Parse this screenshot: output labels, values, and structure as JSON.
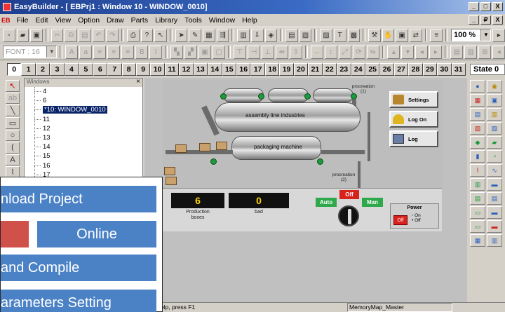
{
  "window": {
    "title": "EasyBuilder - [  EBPrj1  : Window 10  -  WINDOW_0010]",
    "controls": [
      "_",
      "□",
      "X"
    ],
    "mdi_controls": [
      "_",
      "₽",
      "X"
    ]
  },
  "menu": {
    "eb_tag": "EB",
    "items": [
      "File",
      "Edit",
      "View",
      "Option",
      "Draw",
      "Parts",
      "Library",
      "Tools",
      "Window",
      "Help"
    ]
  },
  "toolbar": {
    "zoom": "100 %",
    "font": "FONT : 16"
  },
  "states": {
    "numbers": [
      "0",
      "1",
      "2",
      "3",
      "4",
      "5",
      "6",
      "7",
      "8",
      "9",
      "10",
      "11",
      "12",
      "13",
      "14",
      "15",
      "16",
      "17",
      "18",
      "19",
      "20",
      "21",
      "22",
      "23",
      "24",
      "25",
      "26",
      "27",
      "28",
      "29",
      "30",
      "31"
    ],
    "label": "State  0"
  },
  "windows_panel": {
    "header": "Windows",
    "close": "×",
    "items": [
      "4",
      "6",
      "*10: WINDOW_0010",
      "11",
      "12",
      "13",
      "14",
      "15",
      "16",
      "17"
    ]
  },
  "hmi": {
    "tank_main_label": "assembly line industries",
    "tank_packaging_label": "packaging machine",
    "procreation_1": "procreation\n(1)",
    "procreation_2": "procreation\n(2)",
    "side_buttons": [
      "Settings",
      "Log On",
      "Log"
    ],
    "production_value": "6",
    "production_label": "Production\nboxes",
    "bad_value": "0",
    "bad_label": "bad",
    "auto": "Auto",
    "off": "Off",
    "man": "Man",
    "power_label": "Power",
    "power_off": "Off",
    "power_on": "On",
    "power_off2": "Off"
  },
  "status": {
    "help": "elp, press F1",
    "memory_map": "MemoryMap_Master"
  },
  "overlay": {
    "items": [
      "nload Project",
      "",
      "Online",
      " and Compile",
      "arameters Setting"
    ]
  },
  "colors": {
    "overlay_blue": "#4b82c6",
    "overlay_red": "#d0504a",
    "titlebar": "#1f3f8f"
  }
}
